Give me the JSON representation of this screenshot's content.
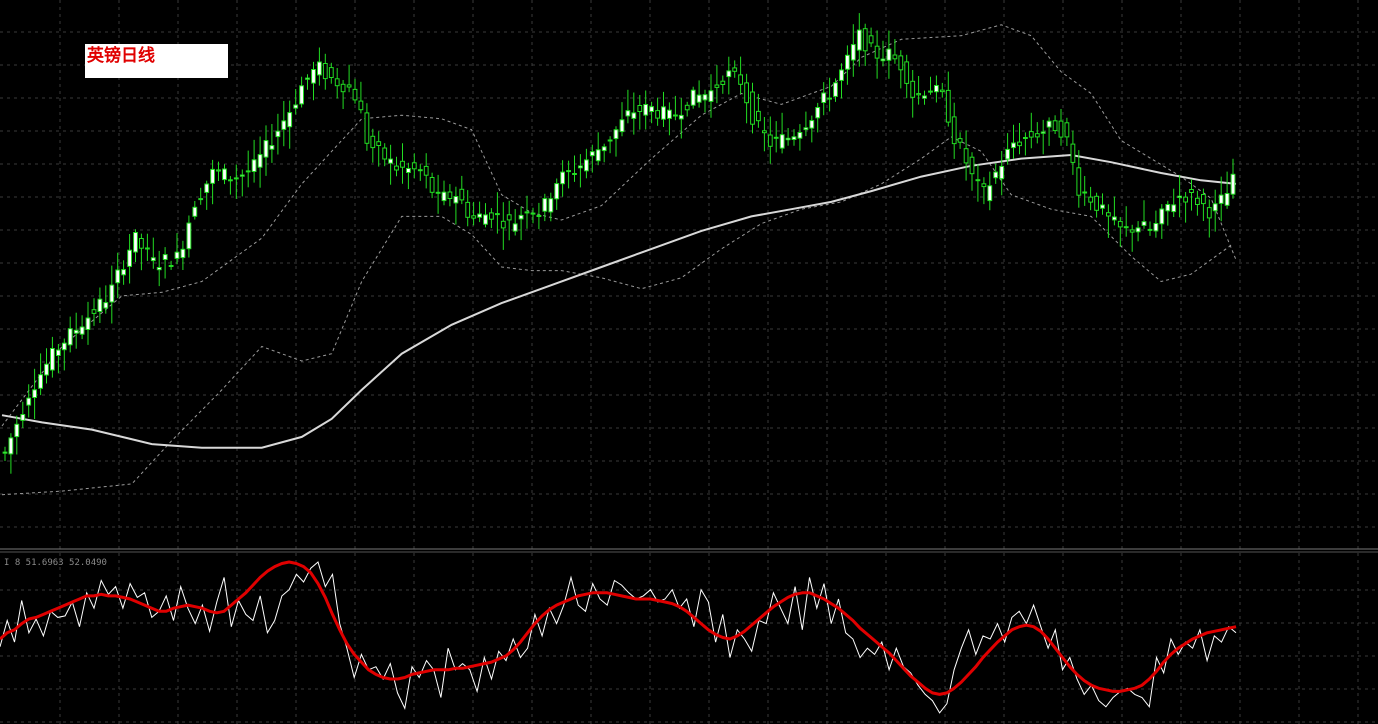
{
  "title": "英镑日线",
  "indicator_label": "I 8 51.6963 52.0490",
  "colors": {
    "background": "#000000",
    "grid": "#3a3a3a",
    "candle": "#22dd22",
    "candle_body_up": "#ffffff",
    "ma": "#d8d8d8",
    "bands": "#9a9a9a",
    "osc_fast": "#ffffff",
    "osc_slow": "#e00000"
  },
  "chart_data": [
    {
      "type": "candlestick",
      "title": "英镑日线",
      "ylim": [
        0,
        100
      ],
      "grid": true,
      "candle_count": 208,
      "close_path": [
        [
          0,
          20
        ],
        [
          20,
          33
        ],
        [
          40,
          48
        ],
        [
          55,
          53
        ],
        [
          65,
          37
        ],
        [
          75,
          40
        ],
        [
          95,
          68
        ],
        [
          105,
          86
        ],
        [
          120,
          70
        ],
        [
          135,
          67
        ],
        [
          150,
          54
        ],
        [
          165,
          60
        ],
        [
          185,
          57
        ],
        [
          205,
          72
        ],
        [
          230,
          80
        ],
        [
          250,
          85
        ],
        [
          260,
          77
        ],
        [
          275,
          68
        ],
        [
          290,
          70
        ],
        [
          307,
          87
        ],
        [
          315,
          92
        ],
        [
          325,
          85
        ],
        [
          345,
          83
        ],
        [
          355,
          94
        ],
        [
          365,
          86
        ],
        [
          380,
          79
        ],
        [
          400,
          66
        ],
        [
          420,
          70
        ],
        [
          437,
          55
        ],
        [
          445,
          67
        ],
        [
          455,
          77
        ],
        [
          470,
          73
        ],
        [
          490,
          81
        ],
        [
          500,
          77
        ],
        [
          518,
          58
        ],
        [
          532,
          59
        ],
        [
          550,
          62
        ],
        [
          565,
          74
        ],
        [
          585,
          70
        ],
        [
          600,
          67
        ],
        [
          605,
          57
        ],
        [
          620,
          63
        ],
        [
          640,
          53
        ],
        [
          660,
          49
        ],
        [
          675,
          53
        ],
        [
          700,
          47
        ],
        [
          735,
          42
        ],
        [
          750,
          31
        ],
        [
          775,
          43
        ],
        [
          800,
          62
        ],
        [
          815,
          64
        ],
        [
          825,
          80
        ],
        [
          850,
          98
        ],
        [
          860,
          92
        ],
        [
          870,
          87
        ],
        [
          880,
          76
        ],
        [
          895,
          72
        ],
        [
          907,
          68
        ],
        [
          915,
          55
        ],
        [
          930,
          58
        ],
        [
          950,
          44
        ],
        [
          965,
          40
        ],
        [
          975,
          35
        ],
        [
          990,
          30
        ],
        [
          1000,
          34
        ],
        [
          1015,
          41
        ],
        [
          1030,
          42
        ],
        [
          1045,
          46
        ],
        [
          1060,
          48
        ],
        [
          1070,
          36
        ],
        [
          1085,
          25
        ],
        [
          1100,
          14
        ],
        [
          1110,
          11
        ],
        [
          1120,
          8
        ],
        [
          1135,
          4
        ],
        [
          1145,
          0
        ],
        [
          1160,
          5
        ],
        [
          1170,
          12
        ],
        [
          1180,
          16
        ],
        [
          1190,
          14
        ],
        [
          1205,
          18
        ],
        [
          1215,
          20
        ],
        [
          1225,
          22
        ],
        [
          1235,
          23
        ],
        [
          1245,
          21
        ],
        [
          1250,
          22
        ],
        [
          1260,
          23
        ],
        [
          1270,
          24
        ],
        [
          1280,
          25
        ],
        [
          1285,
          19
        ],
        [
          1295,
          12
        ],
        [
          1305,
          7
        ],
        [
          1315,
          5
        ],
        [
          1325,
          3
        ],
        [
          1330,
          5
        ],
        [
          1345,
          2
        ],
        [
          1360,
          8
        ],
        [
          1370,
          12
        ],
        [
          1380,
          16
        ],
        [
          1390,
          18
        ],
        [
          1400,
          20
        ],
        [
          1410,
          15
        ],
        [
          1420,
          10
        ],
        [
          1430,
          8
        ],
        [
          1440,
          5
        ],
        [
          1450,
          9
        ],
        [
          1460,
          12
        ],
        [
          1470,
          14
        ],
        [
          1480,
          12
        ],
        [
          1490,
          14
        ],
        [
          1500,
          17
        ],
        [
          1510,
          18
        ],
        [
          1520,
          20
        ],
        [
          1530,
          22
        ],
        [
          1540,
          19
        ],
        [
          1550,
          17
        ],
        [
          1560,
          21
        ],
        [
          1570,
          24
        ],
        [
          1580,
          23
        ],
        [
          1590,
          26
        ],
        [
          1600,
          24
        ],
        [
          1610,
          22
        ],
        [
          1620,
          20
        ],
        [
          1630,
          18
        ],
        [
          1640,
          15
        ],
        [
          1650,
          13
        ],
        [
          1660,
          11
        ],
        [
          1670,
          14
        ],
        [
          1680,
          17
        ],
        [
          1690,
          19
        ],
        [
          1700,
          22
        ],
        [
          1710,
          25
        ],
        [
          1720,
          24
        ],
        [
          1730,
          23
        ],
        [
          1740,
          21
        ],
        [
          1750,
          20
        ],
        [
          1760,
          22
        ],
        [
          1770,
          24
        ],
        [
          1780,
          25
        ],
        [
          1790,
          28
        ],
        [
          1800,
          24
        ],
        [
          1810,
          19
        ],
        [
          1820,
          15
        ],
        [
          1830,
          11
        ],
        [
          1840,
          9
        ],
        [
          1850,
          8
        ]
      ],
      "close_path_note": "",
      "ma_path": [
        [
          0,
          29
        ],
        [
          40,
          27
        ],
        [
          90,
          25
        ],
        [
          150,
          21
        ],
        [
          200,
          20
        ],
        [
          260,
          20
        ],
        [
          300,
          23
        ],
        [
          330,
          28
        ],
        [
          360,
          36
        ],
        [
          400,
          46
        ],
        [
          450,
          54
        ],
        [
          500,
          60
        ],
        [
          550,
          65
        ],
        [
          600,
          70
        ],
        [
          650,
          75
        ],
        [
          700,
          80
        ],
        [
          750,
          84
        ],
        [
          790,
          86
        ],
        [
          830,
          88
        ],
        [
          870,
          91
        ],
        [
          920,
          95
        ],
        [
          970,
          98
        ],
        [
          1020,
          100
        ],
        [
          1070,
          101
        ],
        [
          1110,
          99
        ],
        [
          1160,
          96
        ],
        [
          1200,
          94
        ],
        [
          1235,
          93
        ]
      ],
      "upper_band_path": [
        [
          0,
          26
        ],
        [
          60,
          48
        ],
        [
          120,
          62
        ],
        [
          160,
          63
        ],
        [
          200,
          66
        ],
        [
          260,
          78
        ],
        [
          300,
          93
        ],
        [
          330,
          102
        ],
        [
          360,
          111
        ],
        [
          400,
          112
        ],
        [
          440,
          111
        ],
        [
          470,
          108
        ],
        [
          500,
          90
        ],
        [
          530,
          85
        ],
        [
          560,
          83
        ],
        [
          600,
          87
        ],
        [
          650,
          100
        ],
        [
          700,
          112
        ],
        [
          740,
          118
        ],
        [
          780,
          115
        ],
        [
          830,
          120
        ],
        [
          860,
          128
        ],
        [
          900,
          133
        ],
        [
          960,
          134
        ],
        [
          1000,
          137
        ],
        [
          1030,
          134
        ],
        [
          1060,
          124
        ],
        [
          1090,
          118
        ],
        [
          1120,
          105
        ],
        [
          1150,
          100
        ],
        [
          1180,
          95
        ],
        [
          1210,
          89
        ],
        [
          1235,
          72
        ]
      ],
      "lower_band_path": [
        [
          0,
          7
        ],
        [
          60,
          8
        ],
        [
          130,
          10
        ],
        [
          170,
          22
        ],
        [
          220,
          36
        ],
        [
          260,
          48
        ],
        [
          300,
          44
        ],
        [
          330,
          46
        ],
        [
          360,
          66
        ],
        [
          400,
          84
        ],
        [
          440,
          84
        ],
        [
          470,
          79
        ],
        [
          500,
          70
        ],
        [
          530,
          69
        ],
        [
          560,
          69
        ],
        [
          600,
          67
        ],
        [
          640,
          64
        ],
        [
          680,
          67
        ],
        [
          720,
          75
        ],
        [
          760,
          82
        ],
        [
          800,
          86
        ],
        [
          840,
          88
        ],
        [
          880,
          93
        ],
        [
          920,
          100
        ],
        [
          950,
          106
        ],
        [
          980,
          102
        ],
        [
          1010,
          90
        ],
        [
          1050,
          86
        ],
        [
          1090,
          84
        ],
        [
          1130,
          73
        ],
        [
          1160,
          66
        ],
        [
          1190,
          68
        ],
        [
          1230,
          76
        ]
      ]
    },
    {
      "type": "line",
      "title": "",
      "ylim": [
        0,
        100
      ],
      "series": [
        {
          "name": "",
          "role": "fast",
          "values": [
            45,
            62,
            48,
            75,
            54,
            63,
            52,
            68,
            64,
            65,
            74,
            58,
            80,
            70,
            88,
            79,
            84,
            70,
            86,
            77,
            80,
            64,
            68,
            78,
            62,
            84,
            70,
            60,
            72,
            55,
            74,
            90,
            58,
            75,
            66,
            62,
            78,
            54,
            62,
            78,
            82,
            92,
            87,
            96,
            100,
            84,
            92,
            60,
            44,
            25,
            40,
            30,
            32,
            24,
            34,
            15,
            5,
            32,
            25,
            36,
            30,
            12,
            44,
            30,
            34,
            30,
            16,
            38,
            24,
            42,
            36,
            50,
            38,
            44,
            66,
            52,
            70,
            60,
            72,
            90,
            72,
            68,
            86,
            76,
            72,
            88,
            85,
            80,
            76,
            78,
            82,
            74,
            76,
            82,
            70,
            76,
            58,
            82,
            74,
            48,
            66,
            38,
            56,
            50,
            42,
            62,
            60,
            80,
            70,
            60,
            84,
            56,
            90,
            70,
            86,
            60,
            76,
            54,
            50,
            38,
            44,
            40,
            48,
            30,
            44,
            32,
            28,
            20,
            14,
            10,
            2,
            8,
            30,
            44,
            56,
            40,
            52,
            50,
            60,
            48,
            64,
            68,
            60,
            72,
            58,
            44,
            56,
            30,
            38,
            24,
            14,
            20,
            10,
            6,
            12,
            16,
            18,
            14,
            12,
            6,
            38,
            28,
            50,
            40,
            48,
            44,
            56,
            36,
            52,
            48,
            58,
            54
          ]
        },
        {
          "name": "",
          "role": "slow",
          "values": [
            50,
            54,
            56,
            60,
            63,
            64,
            66,
            68,
            70,
            72,
            74,
            76,
            78,
            78,
            79,
            78,
            78,
            77,
            76,
            74,
            72,
            70,
            68,
            68,
            70,
            71,
            72,
            71,
            70,
            68,
            67,
            68,
            72,
            76,
            80,
            85,
            90,
            94,
            97,
            99,
            100,
            99,
            97,
            93,
            86,
            77,
            66,
            56,
            47,
            40,
            35,
            30,
            27,
            25,
            24,
            24,
            25,
            27,
            28,
            29,
            30,
            30,
            30,
            31,
            31,
            32,
            33,
            34,
            35,
            37,
            39,
            43,
            48,
            54,
            60,
            65,
            69,
            72,
            74,
            76,
            78,
            79,
            80,
            80,
            80,
            79,
            78,
            77,
            76,
            76,
            76,
            75,
            74,
            73,
            71,
            68,
            64,
            60,
            56,
            53,
            51,
            50,
            52,
            55,
            59,
            63,
            67,
            71,
            74,
            77,
            79,
            80,
            80,
            78,
            76,
            73,
            70,
            66,
            62,
            57,
            53,
            49,
            45,
            41,
            36,
            31,
            26,
            22,
            18,
            15,
            14,
            15,
            18,
            22,
            27,
            32,
            38,
            43,
            48,
            52,
            56,
            58,
            59,
            58,
            55,
            50,
            44,
            38,
            32,
            27,
            23,
            20,
            18,
            17,
            16,
            16,
            17,
            18,
            20,
            24,
            29,
            35,
            40,
            44,
            47,
            50,
            52,
            54,
            55,
            56,
            57,
            58
          ]
        }
      ]
    }
  ]
}
